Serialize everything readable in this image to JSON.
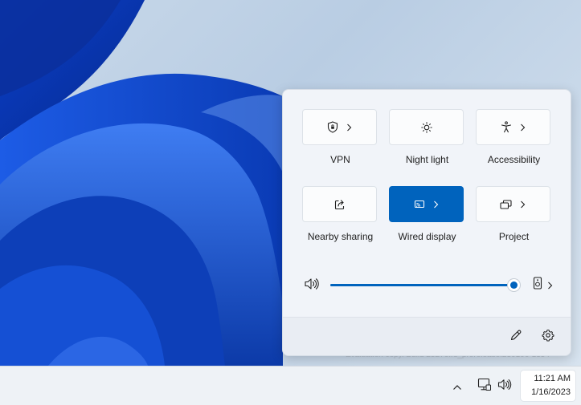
{
  "desktop": {
    "watermark": "Evaluation copy. Build 25276.rs_prerelease.230106-1354"
  },
  "quick_settings": {
    "tiles": [
      {
        "label": "VPN",
        "icon": "shield-icon",
        "has_chevron": true,
        "active": false
      },
      {
        "label": "Night light",
        "icon": "sun-icon",
        "has_chevron": false,
        "active": false
      },
      {
        "label": "Accessibility",
        "icon": "accessibility-icon",
        "has_chevron": true,
        "active": false
      },
      {
        "label": "Nearby sharing",
        "icon": "share-icon",
        "has_chevron": false,
        "active": false
      },
      {
        "label": "Wired display",
        "icon": "cast-icon",
        "has_chevron": true,
        "active": true
      },
      {
        "label": "Project",
        "icon": "project-icon",
        "has_chevron": true,
        "active": false
      }
    ],
    "volume": {
      "level_percent": 100,
      "icon": "speaker-icon",
      "output_icon": "speaker-device-icon"
    },
    "footer": {
      "edit_icon": "pencil-icon",
      "settings_icon": "gear-icon"
    }
  },
  "taskbar": {
    "time": "11:21 AM",
    "date": "1/16/2023",
    "tray_icons": [
      "chevron-up-icon",
      "network-icon",
      "volume-icon"
    ]
  },
  "colors": {
    "accent": "#0063bd",
    "panel_bg": "#f1f4f9",
    "taskbar_bg": "#eef2f6"
  }
}
